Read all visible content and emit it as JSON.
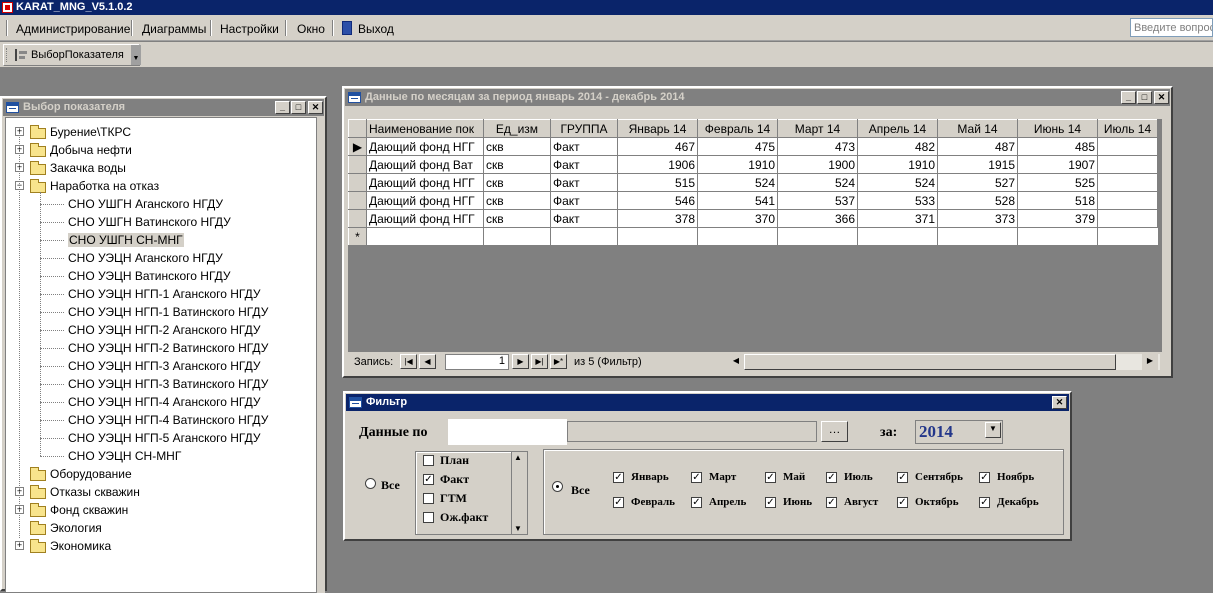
{
  "app": {
    "title": "KARAT_MNG_V5.1.0.2"
  },
  "menu": {
    "items": [
      "Администрирование",
      "Диаграммы",
      "Настройки",
      "Окно",
      "Выход"
    ],
    "ask_placeholder": "Введите вопрос"
  },
  "toolbar": {
    "button_label": "ВыборПоказателя"
  },
  "tree_window": {
    "title": "Выбор показателя",
    "nodes": [
      {
        "label": "Бурение\\ТКРС",
        "type": "folder",
        "expander": "+"
      },
      {
        "label": "Добыча нефти",
        "type": "folder",
        "expander": "+"
      },
      {
        "label": "Закачка воды",
        "type": "folder",
        "expander": "+"
      },
      {
        "label": "Наработка на отказ",
        "type": "folder",
        "expander": "-"
      },
      {
        "label": "СНО УШГН Аганского НГДУ",
        "type": "leaf"
      },
      {
        "label": "СНО УШГН Ватинского НГДУ",
        "type": "leaf"
      },
      {
        "label": "СНО УШГН СН-МНГ",
        "type": "leaf",
        "selected": true
      },
      {
        "label": "СНО УЭЦН Аганского НГДУ",
        "type": "leaf"
      },
      {
        "label": "СНО УЭЦН Ватинского НГДУ",
        "type": "leaf"
      },
      {
        "label": "СНО УЭЦН НГП-1 Аганского НГДУ",
        "type": "leaf"
      },
      {
        "label": "СНО УЭЦН НГП-1 Ватинского НГДУ",
        "type": "leaf"
      },
      {
        "label": "СНО УЭЦН НГП-2 Аганского НГДУ",
        "type": "leaf"
      },
      {
        "label": "СНО УЭЦН НГП-2 Ватинского НГДУ",
        "type": "leaf"
      },
      {
        "label": "СНО УЭЦН НГП-3 Аганского НГДУ",
        "type": "leaf"
      },
      {
        "label": "СНО УЭЦН НГП-3 Ватинского НГДУ",
        "type": "leaf"
      },
      {
        "label": "СНО УЭЦН НГП-4 Аганского НГДУ",
        "type": "leaf"
      },
      {
        "label": "СНО УЭЦН НГП-4 Ватинского НГДУ",
        "type": "leaf"
      },
      {
        "label": "СНО УЭЦН НГП-5 Аганского НГДУ",
        "type": "leaf"
      },
      {
        "label": "СНО УЭЦН СН-МНГ",
        "type": "leaf"
      },
      {
        "label": "Оборудование",
        "type": "folder",
        "expander": ""
      },
      {
        "label": "Отказы скважин",
        "type": "folder",
        "expander": "+"
      },
      {
        "label": "Фонд скважин",
        "type": "folder",
        "expander": "+"
      },
      {
        "label": "Экология",
        "type": "folder",
        "expander": ""
      },
      {
        "label": "Экономика",
        "type": "folder",
        "expander": "+"
      }
    ]
  },
  "data_window": {
    "title": "Данные по месяцам  за период январь  2014 - декабрь  2014",
    "columns": [
      "Наименование пок",
      "Ед_изм",
      "ГРУППА",
      "Январь 14",
      "Февраль 14",
      "Март 14",
      "Апрель 14",
      "Май 14",
      "Июнь 14",
      "Июль 14"
    ],
    "rows": [
      [
        "Дающий фонд НГГ",
        "скв",
        "Факт",
        "467",
        "475",
        "473",
        "482",
        "487",
        "485",
        ""
      ],
      [
        "Дающий фонд Ват",
        "скв",
        "Факт",
        "1906",
        "1910",
        "1900",
        "1910",
        "1915",
        "1907",
        ""
      ],
      [
        "Дающий фонд НГГ",
        "скв",
        "Факт",
        "515",
        "524",
        "524",
        "524",
        "527",
        "525",
        ""
      ],
      [
        "Дающий фонд НГГ",
        "скв",
        "Факт",
        "546",
        "541",
        "537",
        "533",
        "528",
        "518",
        ""
      ],
      [
        "Дающий фонд НГГ",
        "скв",
        "Факт",
        "378",
        "370",
        "366",
        "371",
        "373",
        "379",
        ""
      ]
    ],
    "new_row_marker": "*",
    "nav": {
      "label": "Запись:",
      "current": "1",
      "of_text": "из  5 (Фильтр)"
    }
  },
  "filter_window": {
    "title": "Фильтр",
    "data_label": "Данные по",
    "data_value": "",
    "year_label": "за:",
    "year_value": "2014",
    "all_label_left": "Все",
    "all_label_right": "Все",
    "groups": [
      {
        "label": "План",
        "checked": false
      },
      {
        "label": "Факт",
        "checked": true
      },
      {
        "label": "ГТМ",
        "checked": false
      },
      {
        "label": "Ож.факт",
        "checked": false
      }
    ],
    "months": [
      {
        "label": "Январь",
        "checked": true
      },
      {
        "label": "Февраль",
        "checked": true
      },
      {
        "label": "Март",
        "checked": true
      },
      {
        "label": "Апрель",
        "checked": true
      },
      {
        "label": "Май",
        "checked": true
      },
      {
        "label": "Июнь",
        "checked": true
      },
      {
        "label": "Июль",
        "checked": true
      },
      {
        "label": "Август",
        "checked": true
      },
      {
        "label": "Сентябрь",
        "checked": true
      },
      {
        "label": "Октябрь",
        "checked": true
      },
      {
        "label": "Ноябрь",
        "checked": true
      },
      {
        "label": "Декабрь",
        "checked": true
      }
    ]
  }
}
